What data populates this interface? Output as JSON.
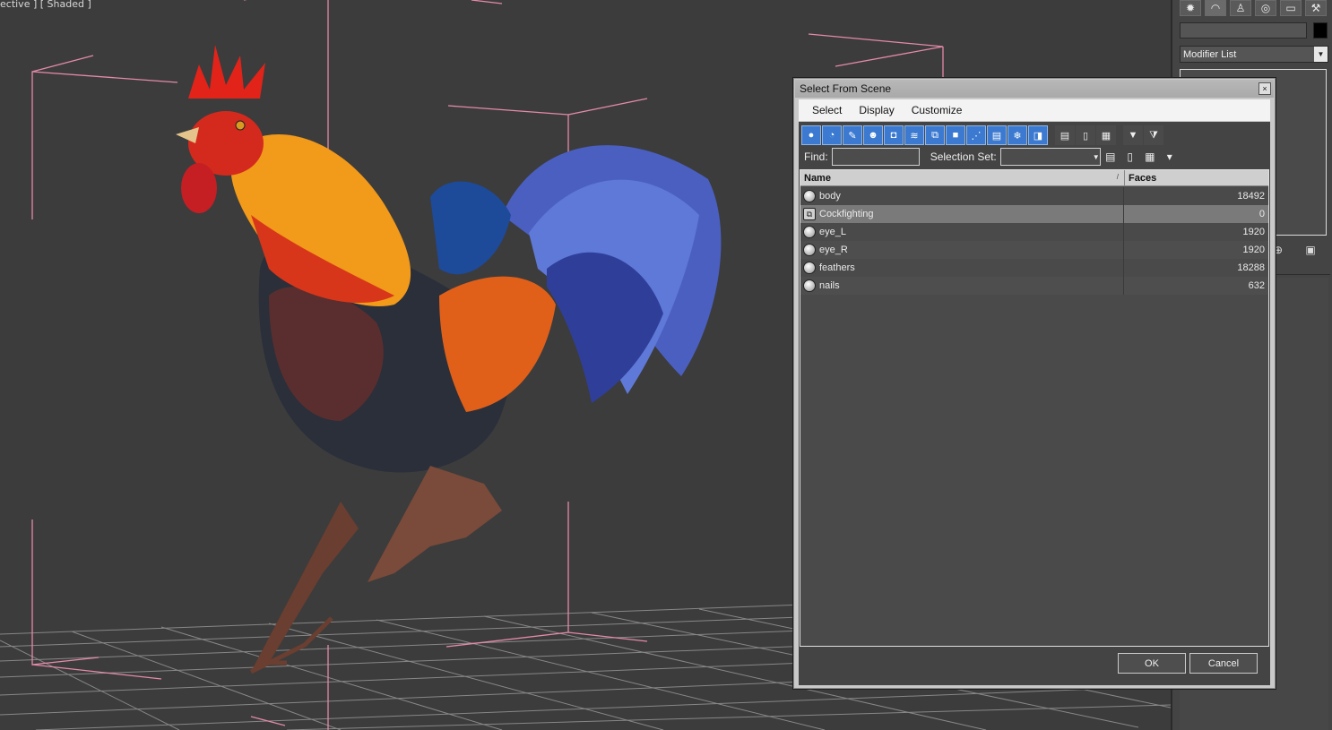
{
  "viewport": {
    "label": "ective ] [ Shaded ]"
  },
  "command_panel": {
    "tabs": [
      "create-icon",
      "modify-icon",
      "hierarchy-icon",
      "motion-icon",
      "display-icon",
      "utilities-icon"
    ],
    "modifier_list": "Modifier List"
  },
  "dialog": {
    "title": "Select From Scene",
    "close_glyph": "×",
    "menu": [
      "Select",
      "Display",
      "Customize"
    ],
    "find_label": "Find:",
    "find_value": "",
    "selection_set_label": "Selection Set:",
    "columns": {
      "name": "Name",
      "faces": "Faces"
    },
    "rows": [
      {
        "name": "body",
        "faces": "18492",
        "icon": "geometry-icon"
      },
      {
        "name": "Cockfighting",
        "faces": "0",
        "icon": "group-icon"
      },
      {
        "name": "eye_L",
        "faces": "1920",
        "icon": "geometry-icon"
      },
      {
        "name": "eye_R",
        "faces": "1920",
        "icon": "geometry-icon"
      },
      {
        "name": "feathers",
        "faces": "18288",
        "icon": "geometry-icon"
      },
      {
        "name": "nails",
        "faces": "632",
        "icon": "geometry-icon"
      }
    ],
    "ok_label": "OK",
    "cancel_label": "Cancel"
  },
  "colors": {
    "toolbar_active": "#3b7ad0",
    "grid_line": "#d8d8d8",
    "bbox_line": "#e48aa8"
  }
}
